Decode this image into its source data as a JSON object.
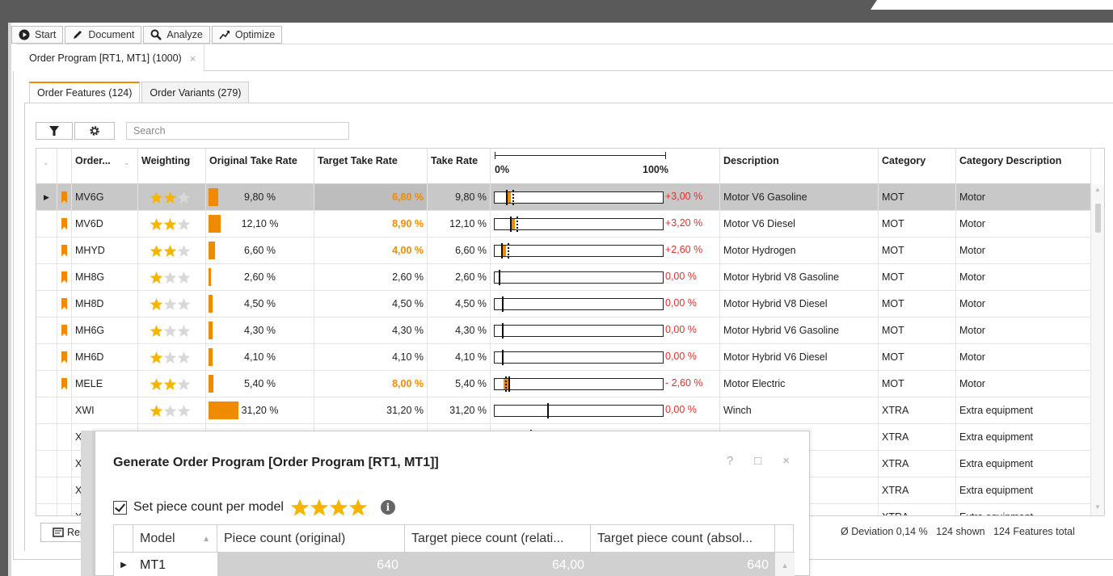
{
  "toolbar": {
    "items": [
      {
        "label": "Start",
        "icon": "play-circle-icon"
      },
      {
        "label": "Document",
        "icon": "pencil-icon"
      },
      {
        "label": "Analyze",
        "icon": "search-icon"
      },
      {
        "label": "Optimize",
        "icon": "trend-up-icon"
      }
    ]
  },
  "doc_tab": {
    "label": "Order Program [RT1, MT1] (1000)",
    "close": "×"
  },
  "inner_tabs": [
    {
      "label": "Order Features (124)",
      "active": true
    },
    {
      "label": "Order Variants (279)",
      "active": false
    }
  ],
  "search": {
    "placeholder": "Search"
  },
  "grid": {
    "headers": {
      "order": "Order...",
      "weighting": "Weighting",
      "original": "Original Take Rate",
      "target": "Target Take Rate",
      "take": "Take Rate",
      "scale_min": "0%",
      "scale_max": "100%",
      "description": "Description",
      "category": "Category",
      "category_desc": "Category Description"
    },
    "rows": [
      {
        "code": "MV6G",
        "bookmark": true,
        "stars": 2,
        "original": "9,80 %",
        "original_val": 9.8,
        "target": "6,80 %",
        "target_highlight": true,
        "take": "9,80 %",
        "take_val": 9.8,
        "target_val": 6.8,
        "deviation": "+3,00 %",
        "description": "Motor V6 Gasoline",
        "category": "MOT",
        "category_desc": "Motor",
        "selected": true
      },
      {
        "code": "MV6D",
        "bookmark": true,
        "stars": 2,
        "original": "12,10 %",
        "original_val": 12.1,
        "target": "8,90 %",
        "target_highlight": true,
        "take": "12,10 %",
        "take_val": 12.1,
        "target_val": 8.9,
        "deviation": "+3,20 %",
        "description": "Motor V6 Diesel",
        "category": "MOT",
        "category_desc": "Motor",
        "selected": false
      },
      {
        "code": "MHYD",
        "bookmark": true,
        "stars": 2,
        "original": "6,60 %",
        "original_val": 6.6,
        "target": "4,00 %",
        "target_highlight": true,
        "take": "6,60 %",
        "take_val": 6.6,
        "target_val": 4.0,
        "deviation": "+2,60 %",
        "description": "Motor Hydrogen",
        "category": "MOT",
        "category_desc": "Motor",
        "selected": false
      },
      {
        "code": "MH8G",
        "bookmark": true,
        "stars": 1,
        "original": "2,60 %",
        "original_val": 2.6,
        "target": "2,60 %",
        "target_highlight": false,
        "take": "2,60 %",
        "take_val": 2.6,
        "target_val": 2.6,
        "deviation": "0,00 %",
        "description": "Motor Hybrid V8 Gasoline",
        "category": "MOT",
        "category_desc": "Motor",
        "selected": false
      },
      {
        "code": "MH8D",
        "bookmark": true,
        "stars": 1,
        "original": "4,50 %",
        "original_val": 4.5,
        "target": "4,50 %",
        "target_highlight": false,
        "take": "4,50 %",
        "take_val": 4.5,
        "target_val": 4.5,
        "deviation": "0,00 %",
        "description": "Motor Hybrid V8 Diesel",
        "category": "MOT",
        "category_desc": "Motor",
        "selected": false
      },
      {
        "code": "MH6G",
        "bookmark": true,
        "stars": 1,
        "original": "4,30 %",
        "original_val": 4.3,
        "target": "4,30 %",
        "target_highlight": false,
        "take": "4,30 %",
        "take_val": 4.3,
        "target_val": 4.3,
        "deviation": "0,00 %",
        "description": "Motor Hybrid V6 Gasoline",
        "category": "MOT",
        "category_desc": "Motor",
        "selected": false
      },
      {
        "code": "MH6D",
        "bookmark": true,
        "stars": 1,
        "original": "4,10 %",
        "original_val": 4.1,
        "target": "4,10 %",
        "target_highlight": false,
        "take": "4,10 %",
        "take_val": 4.1,
        "target_val": 4.1,
        "deviation": "0,00 %",
        "description": "Motor Hybrid V6 Diesel",
        "category": "MOT",
        "category_desc": "Motor",
        "selected": false
      },
      {
        "code": "MELE",
        "bookmark": true,
        "stars": 2,
        "original": "5,40 %",
        "original_val": 5.4,
        "target": "8,00 %",
        "target_highlight": true,
        "take": "5,40 %",
        "take_val": 5.4,
        "target_val": 8.0,
        "deviation": "- 2,60 %",
        "description": "Motor Electric",
        "category": "MOT",
        "category_desc": "Motor",
        "selected": false
      },
      {
        "code": "XWI",
        "bookmark": false,
        "stars": 1,
        "original": "31,20 %",
        "original_val": 31.2,
        "target": "31,20 %",
        "target_highlight": false,
        "take": "31,20 %",
        "take_val": 31.2,
        "target_val": 31.2,
        "deviation": "0,00 %",
        "description": "Winch",
        "category": "XTRA",
        "category_desc": "Extra equipment",
        "selected": false
      },
      {
        "code": "XTQ",
        "bookmark": false,
        "stars": 1,
        "original": "",
        "original_val": 0,
        "target": "",
        "target_highlight": false,
        "take": "",
        "take_val": 21.0,
        "target_val": 21.0,
        "deviation": "",
        "description": "",
        "category": "XTRA",
        "category_desc": "Extra equipment",
        "selected": false
      },
      {
        "code": "XSP",
        "bookmark": false,
        "stars": 0,
        "original": "",
        "original_val": 0,
        "target": "",
        "target_highlight": false,
        "take": "",
        "take_val": 0,
        "target_val": 0,
        "deviation": "",
        "description": "",
        "category": "XTRA",
        "category_desc": "Extra equipment",
        "selected": false
      },
      {
        "code": "XRO",
        "bookmark": false,
        "stars": 0,
        "original": "",
        "original_val": 0,
        "target": "",
        "target_highlight": false,
        "take": "",
        "take_val": 0,
        "target_val": 0,
        "deviation": "",
        "description": "",
        "category": "XTRA",
        "category_desc": "Extra equipment",
        "selected": false
      },
      {
        "code": "XHI",
        "bookmark": false,
        "stars": 0,
        "original": "",
        "original_val": 0,
        "target": "",
        "target_highlight": false,
        "take": "",
        "take_val": 0,
        "target_val": 0,
        "deviation": "",
        "description": "",
        "category": "XTRA",
        "category_desc": "Extra equipment",
        "selected": false
      }
    ]
  },
  "report_button": {
    "label": "Repor"
  },
  "status": {
    "deviation": "Ø Deviation 0,14 %",
    "shown": "124 shown",
    "total": "124 Features total"
  },
  "dialog": {
    "title": "Generate Order Program [Order Program [RT1, MT1]]",
    "help": "?",
    "maximize": "□",
    "close": "×",
    "checkbox_label": "Set piece count per model",
    "checkbox_checked": true,
    "stars": 4,
    "info": "i",
    "columns": [
      "Model",
      "Piece count (original)",
      "Target piece count (relati...",
      "Target piece count (absol..."
    ],
    "rows": [
      {
        "model": "MT1",
        "original": "640",
        "relative": "64,00",
        "absolute": "640"
      }
    ]
  },
  "colors": {
    "accent": "#f08a00",
    "star": "#f7b500",
    "deviation": "#e0312d"
  }
}
